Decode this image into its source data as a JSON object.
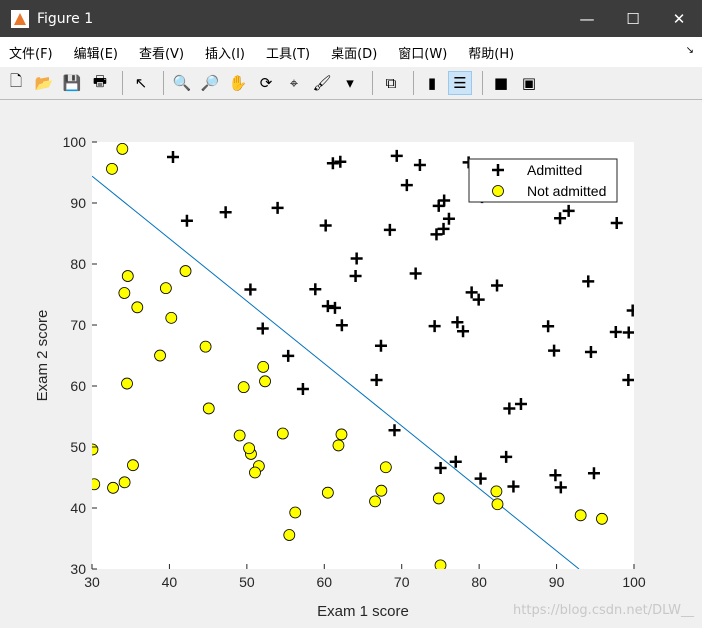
{
  "window": {
    "title": "Figure 1",
    "minimize": "—",
    "maximize": "☐",
    "close": "✕"
  },
  "menu": [
    "文件(F)",
    "编辑(E)",
    "查看(V)",
    "插入(I)",
    "工具(T)",
    "桌面(D)",
    "窗口(W)",
    "帮助(H)"
  ],
  "menu_extra": "↘",
  "toolbar": [
    {
      "icon": "new-figure-icon",
      "glyph": "🗋"
    },
    {
      "icon": "open-icon",
      "glyph": "📂"
    },
    {
      "icon": "save-icon",
      "glyph": "💾"
    },
    {
      "icon": "print-icon",
      "glyph": "🖶"
    },
    {
      "sep": true
    },
    {
      "icon": "pointer-icon",
      "glyph": "↖"
    },
    {
      "sep": true
    },
    {
      "icon": "zoom-in-icon",
      "glyph": "🔍"
    },
    {
      "icon": "zoom-out-icon",
      "glyph": "🔎"
    },
    {
      "icon": "pan-icon",
      "glyph": "✋"
    },
    {
      "icon": "rotate-icon",
      "glyph": "⟳"
    },
    {
      "icon": "data-cursor-icon",
      "glyph": "⌖"
    },
    {
      "icon": "brush-icon",
      "glyph": "🖌"
    },
    {
      "icon": "dropdown-icon",
      "glyph": "▾"
    },
    {
      "sep": true
    },
    {
      "icon": "link-icon",
      "glyph": "⧉"
    },
    {
      "sep": true
    },
    {
      "icon": "colorbar-icon",
      "glyph": "▮"
    },
    {
      "icon": "legend-icon",
      "glyph": "☰",
      "active": true
    },
    {
      "sep": true
    },
    {
      "icon": "hide-plot-tools-icon",
      "glyph": "■"
    },
    {
      "icon": "show-plot-tools-icon",
      "glyph": "▣"
    }
  ],
  "watermark": "https://blog.csdn.net/DLW__",
  "chart_data": {
    "type": "scatter",
    "xlabel": "Exam 1 score",
    "ylabel": "Exam 2 score",
    "xlim": [
      30,
      100
    ],
    "ylim": [
      30,
      100
    ],
    "xticks": [
      30,
      40,
      50,
      60,
      70,
      80,
      90,
      100
    ],
    "yticks": [
      30,
      40,
      50,
      60,
      70,
      80,
      90,
      100
    ],
    "grid": false,
    "legend_position": "top-right",
    "series": [
      {
        "name": "Admitted",
        "marker": "plus",
        "color": "#000000",
        "points": [
          [
            60.18,
            86.31
          ],
          [
            79.03,
            75.34
          ],
          [
            61.11,
            96.51
          ],
          [
            75.02,
            46.55
          ],
          [
            76.1,
            87.42
          ],
          [
            84.43,
            43.53
          ],
          [
            82.31,
            76.48
          ],
          [
            69.36,
            97.72
          ],
          [
            53.97,
            89.21
          ],
          [
            69.07,
            52.74
          ],
          [
            70.66,
            92.93
          ],
          [
            76.98,
            47.58
          ],
          [
            89.68,
            65.8
          ],
          [
            77.92,
            68.97
          ],
          [
            62.27,
            69.95
          ],
          [
            80.19,
            44.82
          ],
          [
            61.38,
            72.81
          ],
          [
            85.4,
            57.05
          ],
          [
            52.05,
            69.43
          ],
          [
            64.18,
            80.91
          ],
          [
            83.9,
            56.31
          ],
          [
            94.44,
            65.57
          ],
          [
            77.19,
            70.46
          ],
          [
            97.77,
            86.73
          ],
          [
            62.07,
            96.77
          ],
          [
            91.56,
            88.7
          ],
          [
            79.94,
            74.16
          ],
          [
            99.27,
            60.99
          ],
          [
            90.55,
            43.39
          ],
          [
            97.65,
            68.86
          ],
          [
            74.25,
            69.82
          ],
          [
            71.8,
            78.45
          ],
          [
            75.4,
            85.76
          ],
          [
            40.46,
            97.54
          ],
          [
            80.28,
            92.12
          ],
          [
            66.75,
            60.99
          ],
          [
            64.04,
            78.03
          ],
          [
            72.35,
            96.23
          ],
          [
            60.46,
            73.09
          ],
          [
            58.84,
            75.86
          ],
          [
            99.83,
            72.37
          ],
          [
            47.26,
            88.48
          ],
          [
            50.46,
            75.81
          ],
          [
            88.91,
            69.8
          ],
          [
            94.83,
            45.69
          ],
          [
            67.32,
            66.59
          ],
          [
            57.24,
            59.51
          ],
          [
            80.37,
            90.96
          ],
          [
            68.47,
            85.59
          ],
          [
            75.48,
            90.42
          ],
          [
            78.64,
            96.65
          ],
          [
            94.09,
            77.16
          ],
          [
            90.45,
            87.51
          ],
          [
            74.49,
            84.85
          ],
          [
            89.85,
            45.36
          ],
          [
            83.49,
            48.38
          ],
          [
            42.26,
            87.1
          ],
          [
            99.32,
            68.78
          ],
          [
            55.34,
            64.93
          ],
          [
            74.78,
            89.53
          ]
        ]
      },
      {
        "name": "Not admitted",
        "marker": "circle",
        "color": "#ffff00",
        "points": [
          [
            34.62,
            78.02
          ],
          [
            30.29,
            43.89
          ],
          [
            35.85,
            72.9
          ],
          [
            45.08,
            56.32
          ],
          [
            95.86,
            38.23
          ],
          [
            75.01,
            30.6
          ],
          [
            39.54,
            76.04
          ],
          [
            67.95,
            46.68
          ],
          [
            67.37,
            42.84
          ],
          [
            50.53,
            48.86
          ],
          [
            34.21,
            44.21
          ],
          [
            93.11,
            38.8
          ],
          [
            61.83,
            50.26
          ],
          [
            38.79,
            64.99
          ],
          [
            52.11,
            63.13
          ],
          [
            40.24,
            71.17
          ],
          [
            54.64,
            52.21
          ],
          [
            33.92,
            98.87
          ],
          [
            74.79,
            41.57
          ],
          [
            34.18,
            75.24
          ],
          [
            51.55,
            46.86
          ],
          [
            82.37,
            40.62
          ],
          [
            51.05,
            45.82
          ],
          [
            62.22,
            52.06
          ],
          [
            34.52,
            60.4
          ],
          [
            50.29,
            49.8
          ],
          [
            49.59,
            59.81
          ],
          [
            32.58,
            95.6
          ],
          [
            35.29,
            47.02
          ],
          [
            56.25,
            39.26
          ],
          [
            30.06,
            49.59
          ],
          [
            44.67,
            66.45
          ],
          [
            66.56,
            41.09
          ],
          [
            49.07,
            51.88
          ],
          [
            32.72,
            43.31
          ],
          [
            60.46,
            42.51
          ],
          [
            82.23,
            42.72
          ],
          [
            42.08,
            78.84
          ],
          [
            52.35,
            60.77
          ],
          [
            55.48,
            35.57
          ]
        ]
      }
    ],
    "decision_boundary": {
      "color": "#0072bd",
      "points": [
        [
          30,
          94.4
        ],
        [
          92.9,
          30
        ]
      ]
    }
  }
}
